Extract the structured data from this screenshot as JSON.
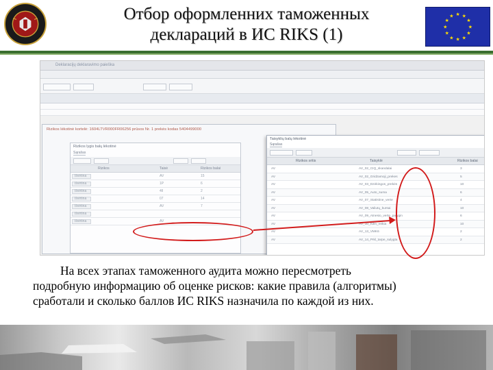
{
  "header": {
    "title_line1": "Отбор оформленних таможенных",
    "title_line2": "деклараций в ИС RIKS (1)",
    "logo_icon": "customs-emblem-icon",
    "flag_icon": "eu-flag-icon"
  },
  "screenshot": {
    "app_title": "Deklaracijų deklaravimo paieška",
    "risk_card_title": "Rizikos lėkotinė kortelė: 1604LTVR000FR06256 prūsos Nr. 1 prekės kodas 5404499000",
    "inner_window": {
      "title": "Rizikos lygis balų lėkotinė",
      "tab": "Sąrašas",
      "columns": [
        "Rizikos",
        "Taisė",
        "Rizikos balai"
      ],
      "rows": [
        {
          "tag": "Išvirtina",
          "a": "AV",
          "b": "15"
        },
        {
          "tag": "Išvirtina",
          "a": "1P",
          "b": "6"
        },
        {
          "tag": "Išvirtina",
          "a": "4Il",
          "b": "2"
        },
        {
          "tag": "Išvirtina",
          "a": "07",
          "b": "14"
        },
        {
          "tag": "Išvirtina",
          "a": "AV",
          "b": "7"
        },
        {
          "tag": "Išvirtina",
          "a": "",
          "b": ""
        },
        {
          "tag": "Išvirtina",
          "a": "AV",
          "b": ""
        }
      ]
    },
    "rules_window": {
      "title": "Taisyklių balų lėkotinė",
      "tab": "Sąrašas",
      "columns": [
        "Rizikos sritis",
        "Taisyklė",
        "Rizikos balai"
      ],
      "rows": [
        {
          "area": "AV",
          "rule": "AV_02_CIQ_skandalai",
          "score": "3"
        },
        {
          "area": "AV",
          "rule": "AV_02_Gridzamoji_prekes",
          "score": "5"
        },
        {
          "area": "AV",
          "rule": "AV_03_Dzėkingos_prekės",
          "score": "10"
        },
        {
          "area": "AV",
          "rule": "AV_05_Auto_suma",
          "score": "6"
        },
        {
          "area": "AV",
          "rule": "AV_07_Statistine_verte",
          "score": "4"
        },
        {
          "area": "AV",
          "rule": "AV_08_Valiutų_kursai",
          "score": "10"
        },
        {
          "area": "AV",
          "rule": "AV_09_Atnesio_verte_palygin",
          "score": "6"
        },
        {
          "area": "AV",
          "rule": "AV_10_Kilm_reikia",
          "score": "10"
        },
        {
          "area": "AV",
          "rule": "AV_13_VMK6",
          "score": "2"
        },
        {
          "area": "AV",
          "rule": "AV_14_Prkl_tarpe_sulygta",
          "score": "2"
        }
      ]
    }
  },
  "caption": {
    "line1": "На всех этапах таможенного аудита можно пересмотреть",
    "line2": "подробную информацию об оценке рисков: какие правила (алгоритмы)",
    "line3": "сработали и сколько баллов ИС RIKS назначила по каждой из них."
  },
  "colors": {
    "accent_red": "#d21b1b",
    "header_green": "#3a6e2f",
    "eu_blue": "#1f2fa8",
    "eu_star": "#ffde00"
  }
}
